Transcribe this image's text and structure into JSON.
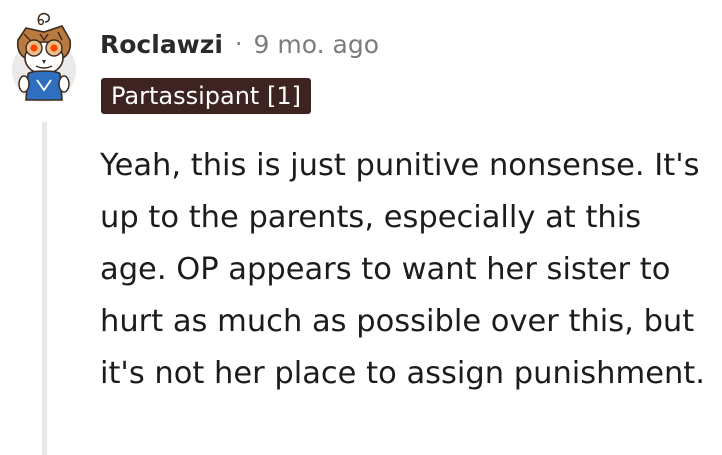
{
  "comment": {
    "author": "Roclawzi",
    "separator": "·",
    "timestamp": "9 mo. ago",
    "flair": "Partassipant [1]",
    "body": "Yeah, this is just punitive nonsense. It's up to the parents, especially at this age. OP appears to want her sister to hurt as much as possible over this, but it's not her place to assign punishment."
  },
  "avatar": {
    "icon": "snoo-owl-costume-icon",
    "colors": {
      "owl_body": "#b87a3e",
      "owl_dark": "#3d2a1e",
      "eye_glow": "#ff4500",
      "shirt": "#2f6fbf",
      "background": "#eaeaea"
    }
  },
  "colors": {
    "flair_background": "#3d2420",
    "flair_text": "#ffffff",
    "username": "#2a2a2a",
    "meta_text": "#7c7c7c",
    "body_text": "#1c1c1c",
    "thread_line": "#e8e8e8"
  }
}
